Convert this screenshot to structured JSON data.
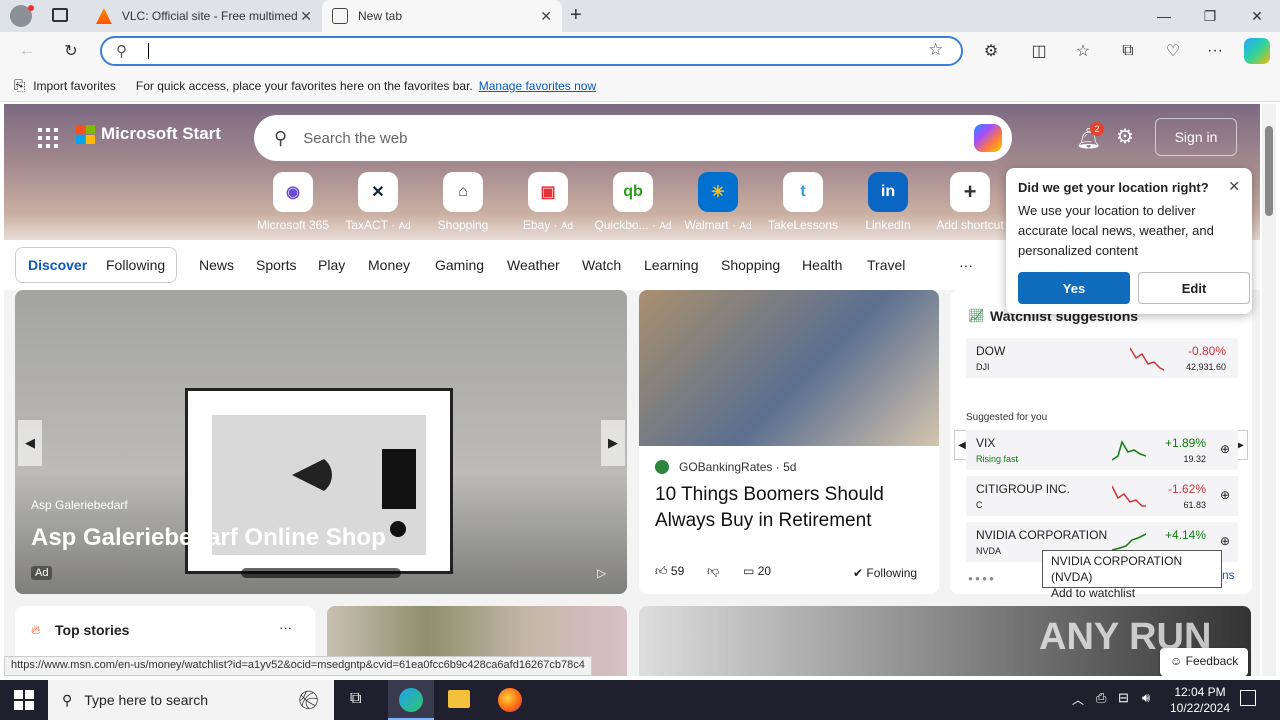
{
  "browser": {
    "tabs": [
      {
        "title": "VLC: Official site - Free multimed",
        "active": false
      },
      {
        "title": "New tab",
        "active": true
      }
    ],
    "address_placeholder": "",
    "favbar_import": "Import favorites",
    "favbar_text": "For quick access, place your favorites here on the favorites bar.",
    "favbar_link": "Manage favorites now"
  },
  "msn": {
    "brand": "Microsoft Start",
    "search_placeholder": "Search the web",
    "notif_count": "2",
    "sign_in": "Sign in",
    "quicklinks": [
      {
        "label": "Microsoft 365",
        "ad": ""
      },
      {
        "label": "TaxACT",
        "ad": "Ad"
      },
      {
        "label": "Shopping",
        "ad": ""
      },
      {
        "label": "Ebay",
        "ad": "Ad"
      },
      {
        "label": "Quickbo...",
        "ad": "Ad"
      },
      {
        "label": "Walmart",
        "ad": "Ad"
      },
      {
        "label": "TakeLessons",
        "ad": ""
      },
      {
        "label": "LinkedIn",
        "ad": ""
      },
      {
        "label": "Add shortcut",
        "ad": ""
      }
    ],
    "nav": [
      "Discover",
      "Following",
      "News",
      "Sports",
      "Play",
      "Money",
      "Gaming",
      "Weather",
      "Watch",
      "Learning",
      "Shopping",
      "Health",
      "Travel",
      "···"
    ],
    "hero": {
      "source": "Asp Galeriebedarf",
      "title": "Asp Galeriebedarf Online Shop",
      "ad": "Ad"
    },
    "article": {
      "source": "GOBankingRates",
      "age": "5d",
      "title": "10 Things Boomers Should Always Buy in Retirement",
      "likes": "59",
      "comments": "20",
      "following": "Following"
    },
    "watchlist": {
      "title": "Watchlist suggestions",
      "suggested": "Suggested for you",
      "stocks": [
        {
          "name": "DOW",
          "sym": "DJI",
          "change": "-0.80%",
          "price": "42,931.60",
          "up": false
        },
        {
          "name": "VIX",
          "sym": "Rising fast",
          "change": "+1.89%",
          "price": "19.32",
          "up": true
        },
        {
          "name": "CITIGROUP INC.",
          "sym": "C",
          "change": "-1.62%",
          "price": "61.83",
          "up": false
        },
        {
          "name": "NVIDIA CORPORATION",
          "sym": "NVDA",
          "change": "+4.14%",
          "price": "",
          "up": true
        }
      ],
      "tooltip_line1": "NVIDIA CORPORATION (NVDA)",
      "tooltip_line2": "Add to watchlist",
      "more": "ns"
    },
    "location_popup": {
      "title": "Did we get your location right?",
      "body": "We use your location to deliver accurate local news, weather, and personalized content",
      "yes": "Yes",
      "edit": "Edit"
    },
    "top_stories": "Top stories",
    "feedback": "Feedback",
    "watermark": "ANY RUN"
  },
  "status_url": "https://www.msn.com/en-us/money/watchlist?id=a1yv52&ocid=msedgntp&cvid=61ea0fcc6b9c428ca6afd16267cb78c4",
  "taskbar": {
    "search_placeholder": "Type here to search",
    "time": "12:04 PM",
    "date": "10/22/2024"
  }
}
